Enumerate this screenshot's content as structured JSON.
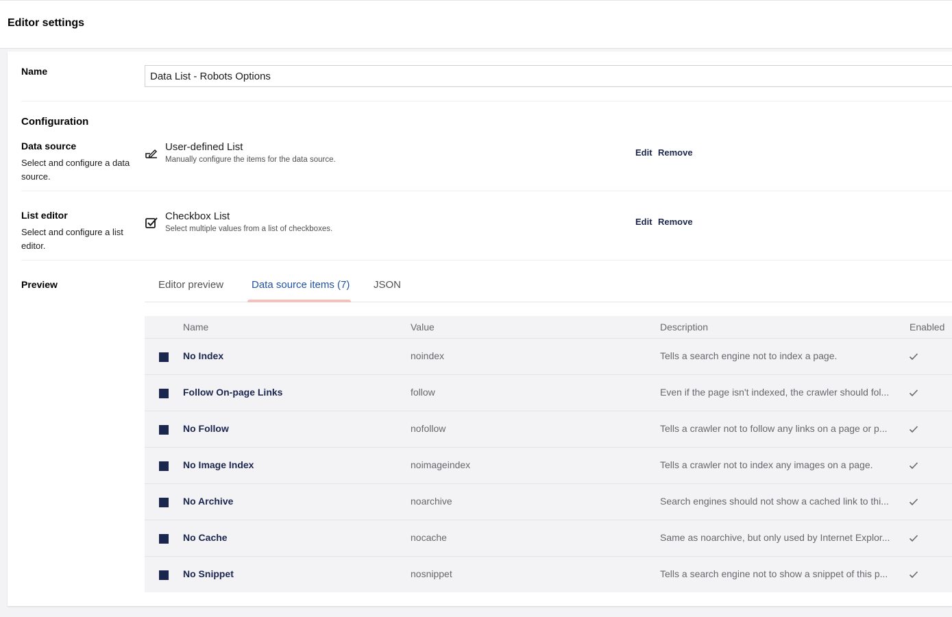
{
  "header": {
    "title": "Editor settings"
  },
  "name_field": {
    "label": "Name",
    "value": "Data List - Robots Options"
  },
  "configuration": {
    "title": "Configuration",
    "data_source": {
      "label": "Data source",
      "description": "Select and configure a data source.",
      "item_title": "User-defined List",
      "item_description": "Manually configure the items for the data source.",
      "icon": "edit-list-icon",
      "edit_label": "Edit",
      "remove_label": "Remove"
    },
    "list_editor": {
      "label": "List editor",
      "description": "Select and configure a list editor.",
      "item_title": "Checkbox List",
      "item_description": "Select multiple values from a list of checkboxes.",
      "icon": "checkbox-icon",
      "edit_label": "Edit",
      "remove_label": "Remove"
    }
  },
  "preview": {
    "label": "Preview",
    "tabs": [
      {
        "label": "Editor preview",
        "active": false
      },
      {
        "label": "Data source items (7)",
        "active": true
      },
      {
        "label": "JSON",
        "active": false
      }
    ],
    "table": {
      "columns": [
        "Name",
        "Value",
        "Description",
        "Enabled"
      ],
      "rows": [
        {
          "name": "No Index",
          "value": "noindex",
          "description": "Tells a search engine not to index a page.",
          "enabled": true
        },
        {
          "name": "Follow On-page Links",
          "value": "follow",
          "description": "Even if the page isn't indexed, the crawler should fol...",
          "enabled": true
        },
        {
          "name": "No Follow",
          "value": "nofollow",
          "description": "Tells a crawler not to follow any links on a page or p...",
          "enabled": true
        },
        {
          "name": "No Image Index",
          "value": "noimageindex",
          "description": "Tells a crawler not to index any images on a page.",
          "enabled": true
        },
        {
          "name": "No Archive",
          "value": "noarchive",
          "description": "Search engines should not show a cached link to thi...",
          "enabled": true
        },
        {
          "name": "No Cache",
          "value": "nocache",
          "description": "Same as noarchive, but only used by Internet Explor...",
          "enabled": true
        },
        {
          "name": "No Snippet",
          "value": "nosnippet",
          "description": "Tells a search engine not to show a snippet of this p...",
          "enabled": true
        }
      ]
    }
  },
  "colors": {
    "primary": "#1b264f",
    "active_tab": "#2152a3",
    "tab_underline": "#f5c1bc",
    "muted_text": "#68676b",
    "table_bg": "#f3f3f5"
  }
}
